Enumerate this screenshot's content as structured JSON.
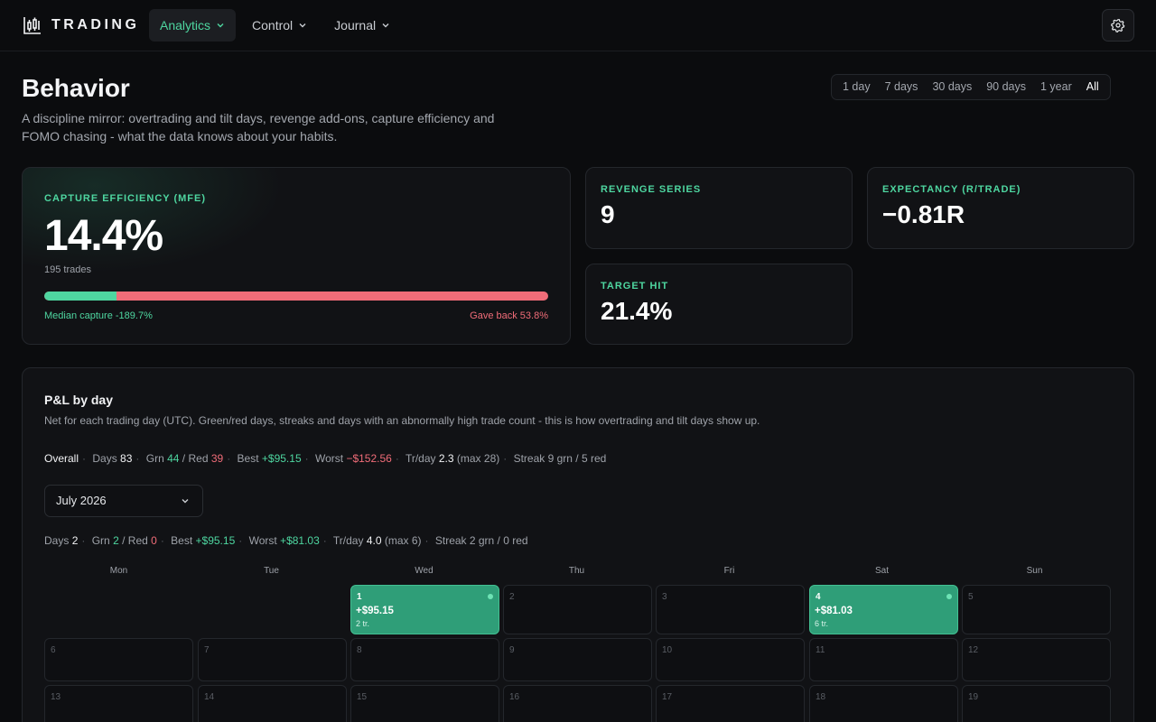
{
  "app": {
    "name": "TRADING"
  },
  "nav": [
    {
      "label": "Analytics",
      "active": true
    },
    {
      "label": "Control",
      "active": false
    },
    {
      "label": "Journal",
      "active": false
    }
  ],
  "header": {
    "title": "Behavior",
    "subtitle": "A discipline mirror: overtrading and tilt days, revenge add-ons, capture efficiency and FOMO chasing - what the data knows about your habits."
  },
  "range": {
    "options": [
      "1 day",
      "7 days",
      "30 days",
      "90 days",
      "1 year",
      "All"
    ],
    "selected": "All"
  },
  "capture": {
    "label": "CAPTURE EFFICIENCY (MFE)",
    "value": "14.4%",
    "trades": "195 trades",
    "fraction": 0.144,
    "median": "Median capture -189.7%",
    "gave_back": "Gave back 53.8%"
  },
  "revenge": {
    "label": "REVENGE SERIES",
    "value": "9"
  },
  "expectancy": {
    "label": "EXPECTANCY (R/TRADE)",
    "value": "−0.81R"
  },
  "target": {
    "label": "TARGET HIT",
    "value": "21.4%"
  },
  "pnl": {
    "title": "P&L by day",
    "description": "Net for each trading day (UTC). Green/red days, streaks and days with an abnormally high trade count - this is how overtrading and tilt days show up.",
    "overall": {
      "label": "Overall",
      "days_label": "Days",
      "days": "83",
      "grn_label": "Grn",
      "grn": "44",
      "red_label": "Red",
      "red": "39",
      "best_label": "Best",
      "best": "+$95.15",
      "worst_label": "Worst",
      "worst": "−$152.56",
      "trday_label": "Tr/day",
      "trday": "2.3",
      "trday_max": "(max 28)",
      "streak": "Streak 9 grn / 5 red"
    },
    "month_select": "July 2026",
    "month": {
      "days_label": "Days",
      "days": "2",
      "grn_label": "Grn",
      "grn": "2",
      "red_label": "Red",
      "red": "0",
      "best_label": "Best",
      "best": "+$95.15",
      "worst_label": "Worst",
      "worst": "+$81.03",
      "trday_label": "Tr/day",
      "trday": "4.0",
      "trday_max": "(max 6)",
      "streak": "Streak 2 grn / 0 red"
    },
    "weekdays": [
      "Mon",
      "Tue",
      "Wed",
      "Thu",
      "Fri",
      "Sat",
      "Sun"
    ],
    "days": [
      {
        "day": "1",
        "pnl": "+$95.15",
        "trades": "2 tr."
      },
      {
        "day": "2"
      },
      {
        "day": "3"
      },
      {
        "day": "4",
        "pnl": "+$81.03",
        "trades": "6 tr."
      },
      {
        "day": "5"
      },
      {
        "day": "6"
      },
      {
        "day": "7"
      },
      {
        "day": "8"
      },
      {
        "day": "9"
      },
      {
        "day": "10"
      },
      {
        "day": "11"
      },
      {
        "day": "12"
      },
      {
        "day": "13"
      },
      {
        "day": "14"
      },
      {
        "day": "15"
      },
      {
        "day": "16"
      },
      {
        "day": "17"
      },
      {
        "day": "18"
      },
      {
        "day": "19"
      }
    ]
  },
  "colors": {
    "accent": "#4ed6a0",
    "negative": "#f06c78",
    "win_day": "#2f9e78",
    "background": "#0b0c0e"
  }
}
